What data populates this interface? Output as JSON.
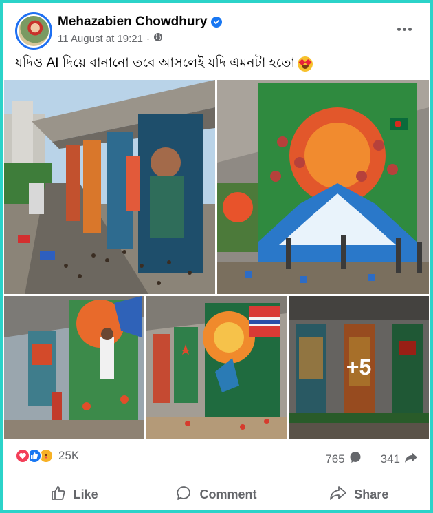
{
  "post": {
    "author": "Mehazabien Chowdhury",
    "timestamp": "11 August at 19:21",
    "separator": "·",
    "caption": "যদিও AI দিয়ে বানানো তবে আসলেই যদি এমনটা হতো",
    "more_photos_label": "+5"
  },
  "icons": {
    "verified": "verified-badge-icon",
    "audience": "globe-icon",
    "menu": "more-options-icon",
    "caption_emoji": "heart-eyes-emoji-icon"
  },
  "reactions": {
    "types": [
      "love",
      "like",
      "care"
    ],
    "count": "25K",
    "comments": "765",
    "shares": "341"
  },
  "actions": {
    "like_label": "Like",
    "comment_label": "Comment",
    "share_label": "Share"
  },
  "colors": {
    "accent": "#1877f2",
    "love": "#f33e58",
    "care": "#f7b125",
    "border": "#2bd3c9",
    "secondary_text": "#65676b"
  }
}
